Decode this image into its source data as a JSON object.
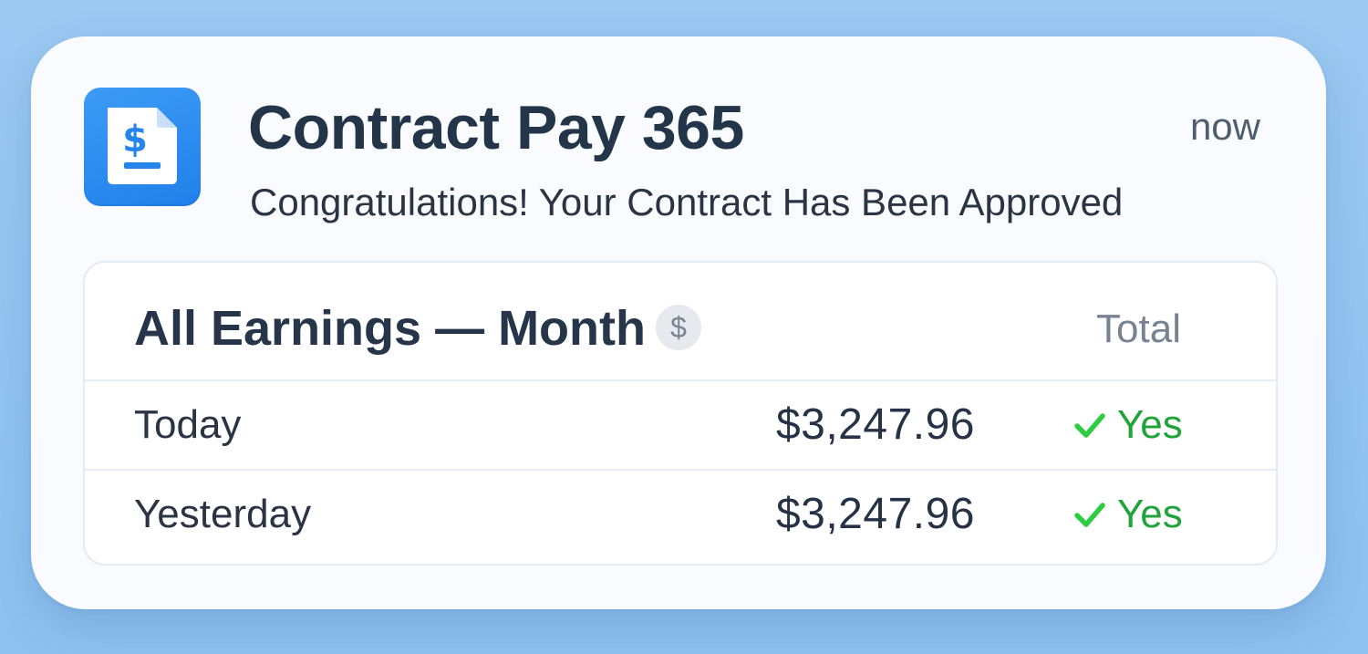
{
  "notification": {
    "app_name": "Contract Pay 365",
    "time": "now",
    "message": "Congratulations! Your Contract Has Been Approved",
    "app_icon": "document-dollar-icon"
  },
  "earnings": {
    "title": "All Earnings — Month",
    "title_icon": "dollar-circle-icon",
    "total_label": "Total",
    "rows": [
      {
        "label": "Today",
        "amount": "$3,247.96",
        "status": "Yes",
        "status_icon": "checkmark-icon"
      },
      {
        "label": "Yesterday",
        "amount": "$3,247.96",
        "status": "Yes",
        "status_icon": "checkmark-icon"
      }
    ]
  },
  "colors": {
    "background": "#9cc9f2",
    "icon_blue": "#2f8ef0",
    "status_green": "#22a33a",
    "check_green": "#2ecc40"
  }
}
